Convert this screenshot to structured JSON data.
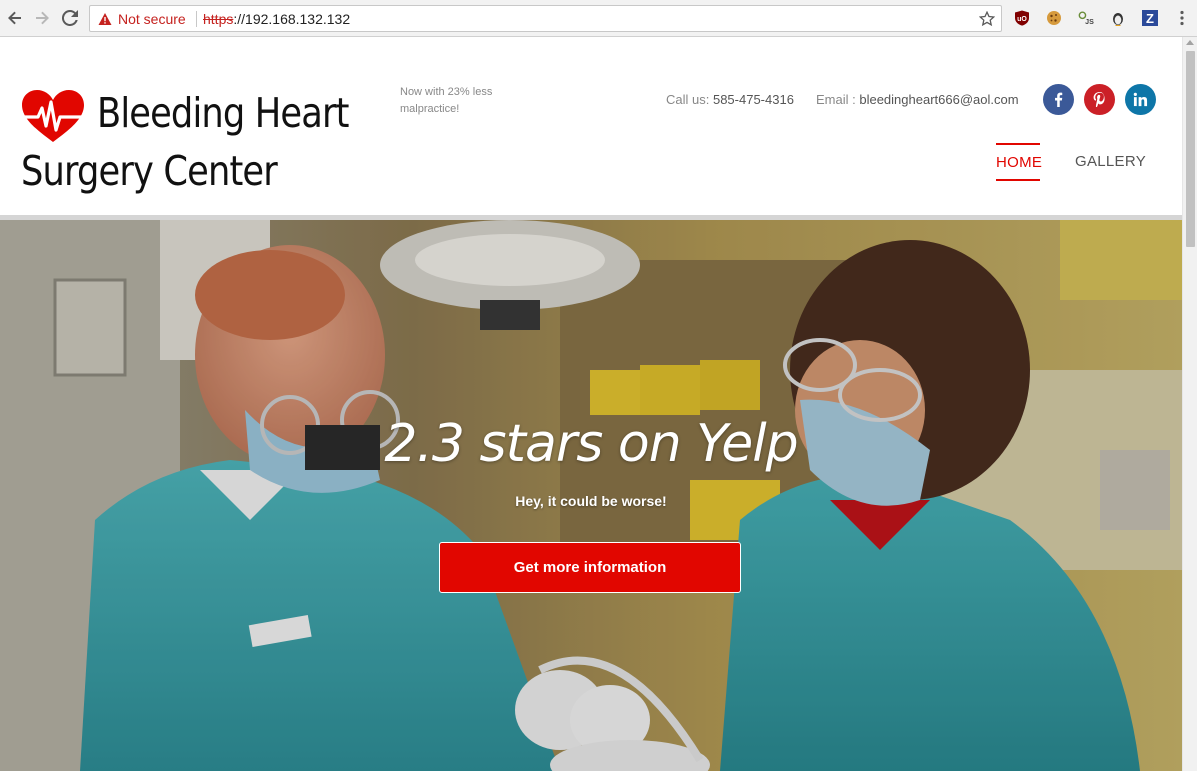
{
  "browser": {
    "security_label": "Not secure",
    "url_scheme": "https",
    "url_rest": "://192.168.132.132",
    "extensions": [
      {
        "name": "ublock-origin-icon",
        "label": "uO",
        "color": "#800000"
      },
      {
        "name": "cookie-icon",
        "label": "",
        "color": "#d69a3c"
      },
      {
        "name": "javascript-toggle-icon",
        "label": "JS",
        "color": "#6a8d3a"
      },
      {
        "name": "user-agent-icon",
        "label": "",
        "color": "#777777"
      },
      {
        "name": "zotero-icon",
        "label": "Z",
        "color": "#2b4a9a"
      }
    ]
  },
  "header": {
    "brand_line1": "Bleeding Heart",
    "brand_line2": "Surgery Center",
    "tagline": "Now with 23% less malpractice!",
    "phone_label": "Call us: ",
    "phone_value": "585-475-4316",
    "email_label": "Email : ",
    "email_value": "bleedingheart666@aol.com",
    "social": [
      {
        "name": "facebook-icon",
        "color": "#3b5998"
      },
      {
        "name": "pinterest-icon",
        "color": "#cb2027"
      },
      {
        "name": "linkedin-icon",
        "color": "#0e76a8"
      }
    ],
    "menu": [
      {
        "label": "HOME",
        "active": true
      },
      {
        "label": "GALLERY",
        "active": false
      }
    ]
  },
  "hero": {
    "title": "2.3 stars on Yelp",
    "subtitle": "Hey, it could be worse!",
    "cta_label": "Get more information"
  },
  "colors": {
    "accent": "#e10600"
  }
}
